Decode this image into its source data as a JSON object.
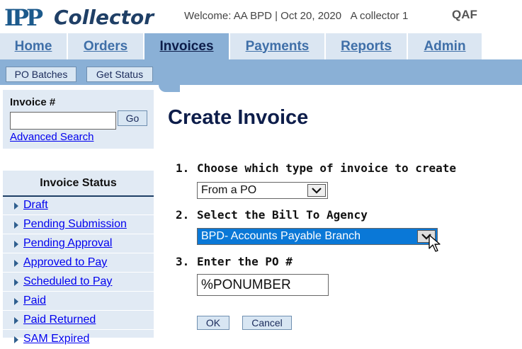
{
  "header": {
    "logo_mark": "IPP",
    "logo_text": "Collector",
    "welcome": "Welcome: AA BPD | Oct 20, 2020",
    "user_role": "A collector 1",
    "environment": "QAF"
  },
  "nav": {
    "tabs": [
      {
        "label": "Home",
        "active": false
      },
      {
        "label": "Orders",
        "active": false
      },
      {
        "label": "Invoices",
        "active": true
      },
      {
        "label": "Payments",
        "active": false
      },
      {
        "label": "Reports",
        "active": false
      },
      {
        "label": "Admin",
        "active": false
      }
    ]
  },
  "subbar": {
    "po_batches": "PO Batches",
    "get_status": "Get Status"
  },
  "search": {
    "label": "Invoice #",
    "value": "",
    "go": "Go",
    "advanced": "Advanced Search"
  },
  "status_panel": {
    "title": "Invoice Status",
    "items": [
      "Draft",
      "Pending Submission",
      "Pending Approval",
      "Approved to Pay",
      "Scheduled to Pay",
      "Paid",
      "Paid Returned",
      "SAM Expired"
    ]
  },
  "form": {
    "title": "Create Invoice",
    "step1": {
      "number": "1.",
      "label": "Choose which type of invoice to create",
      "value": "From a PO"
    },
    "step2": {
      "number": "2.",
      "label": "Select the Bill To Agency",
      "value": "BPD- Accounts Payable Branch"
    },
    "step3": {
      "number": "3.",
      "label": "Enter the PO #",
      "value": "%PONUMBER"
    },
    "ok": "OK",
    "cancel": "Cancel"
  },
  "colors": {
    "nav_bg": "#dbe6f2",
    "nav_active": "#8ab0d6",
    "panel_bg": "#e1eaf4",
    "title_navy": "#0d1d4a",
    "select_focus": "#0a78d7"
  }
}
